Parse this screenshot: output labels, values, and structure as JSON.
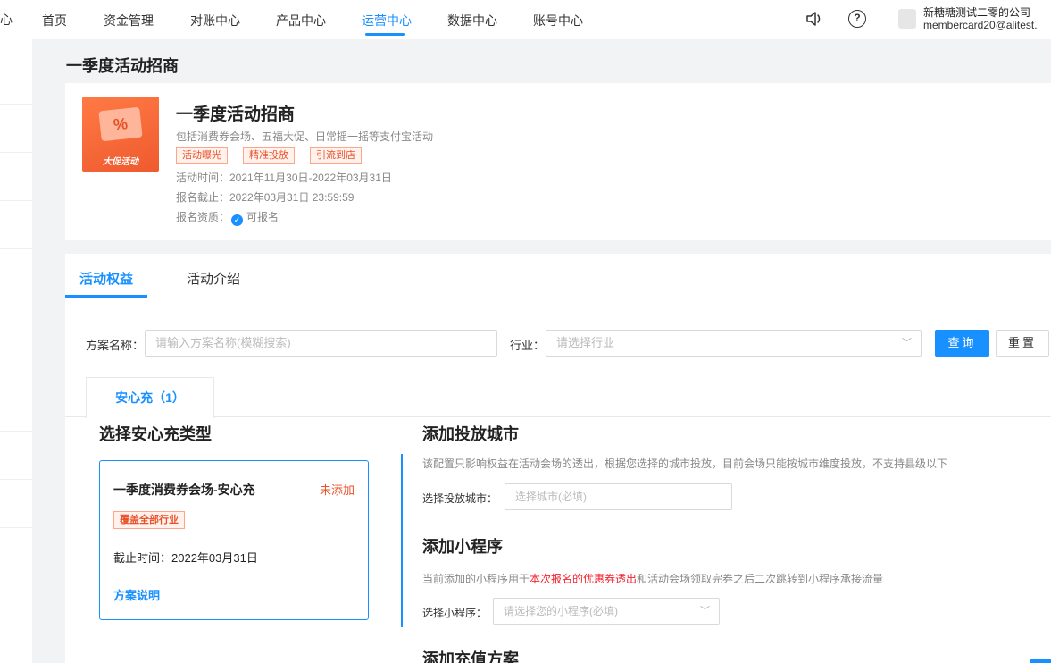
{
  "nav": {
    "logo_fragment": "心",
    "items": [
      "首页",
      "资金管理",
      "对账中心",
      "产品中心",
      "运营中心",
      "数据中心",
      "账号中心"
    ],
    "active_index": 4,
    "company": "新糖糖测试二零的公司",
    "email": "membercard20@alitest.",
    "icons": [
      "sound-icon",
      "help-icon",
      "avatar"
    ]
  },
  "page": {
    "title": "一季度活动招商"
  },
  "activity": {
    "thumb_label": "大促活动",
    "thumb_glyph": "%",
    "title": "一季度活动招商",
    "desc": "包括消费券会场、五福大促、日常摇一摇等支付宝活动",
    "tags": [
      "活动曝光",
      "精准投放",
      "引流到店"
    ],
    "time": "活动时间：2021年11月30日-2022年03月31日",
    "deadline": "报名截止：2022年03月31日 23:59:59",
    "qualification_label": "报名资质：",
    "qualification_value": "可报名"
  },
  "tabs": [
    "活动权益",
    "活动介绍"
  ],
  "filter": {
    "name_label": "方案名称：",
    "name_placeholder": "请输入方案名称(模糊搜索)",
    "industry_label": "行业：",
    "industry_placeholder": "请选择行业",
    "query": "查询",
    "reset": "重置"
  },
  "subtab": "安心充（1）",
  "type_section": {
    "title": "选择安心充类型",
    "card": {
      "name": "一季度消费券会场-安心充",
      "status": "未添加",
      "tag": "覆盖全部行业",
      "deadline": "截止时间：2022年03月31日",
      "link": "方案说明"
    }
  },
  "city_section": {
    "title": "添加投放城市",
    "hint": "该配置只影响权益在活动会场的透出，根据您选择的城市投放，目前会场只能按城市维度投放，不支持县级以下",
    "label": "选择投放城市：",
    "placeholder": "选择城市(必填)"
  },
  "mini_section": {
    "title": "添加小程序",
    "hint_prefix": "当前添加的小程序用于",
    "hint_red": "本次报名的优惠券透出",
    "hint_suffix": "和活动会场领取完券之后二次跳转到小程序承接流量",
    "label": "选择小程序：",
    "placeholder": "请选择您的小程序(必填)"
  },
  "recharge_section": {
    "title": "添加充值方案"
  },
  "colors": {
    "accent": "#1890ff",
    "warn": "#e8522a"
  }
}
